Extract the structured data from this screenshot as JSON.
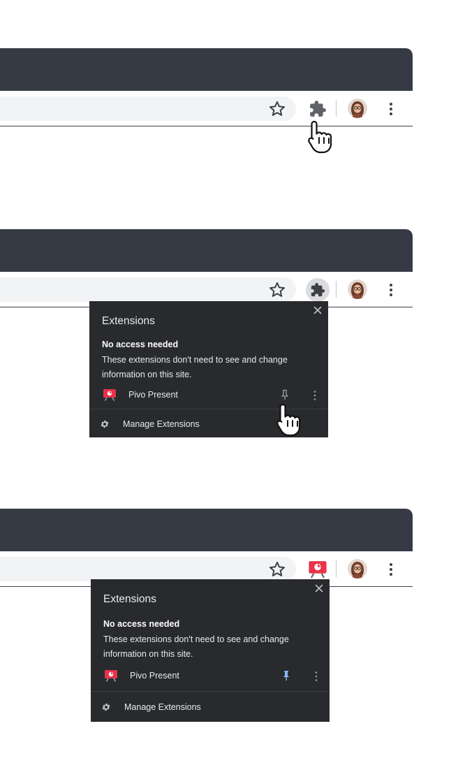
{
  "frames": [
    {
      "state": "initial",
      "toolbar": {
        "star_icon": "star-icon",
        "extensions_icon": "puzzle-piece-icon",
        "avatar_icon": "avatar",
        "menu_icon": "vertical-dots-icon"
      }
    },
    {
      "state": "popup-open",
      "popup": {
        "title": "Extensions",
        "section_heading": "No access needed",
        "section_description": "These extensions don't need to see and change information on this site.",
        "extension_name": "Pivo Present",
        "pinned": false,
        "manage_label": "Manage Extensions"
      }
    },
    {
      "state": "pinned",
      "popup": {
        "title": "Extensions",
        "section_heading": "No access needed",
        "section_description": "These extensions don't need to see and change information on this site.",
        "extension_name": "Pivo Present",
        "pinned": true,
        "manage_label": "Manage Extensions"
      }
    }
  ],
  "colors": {
    "tabstrip": "#363a45",
    "omnibox": "#f1f3f4",
    "popup_bg": "#292a2d",
    "extension_red": "#e8334a",
    "pin_active": "#8ab4f8",
    "pin_inactive": "#9aa0a6"
  }
}
